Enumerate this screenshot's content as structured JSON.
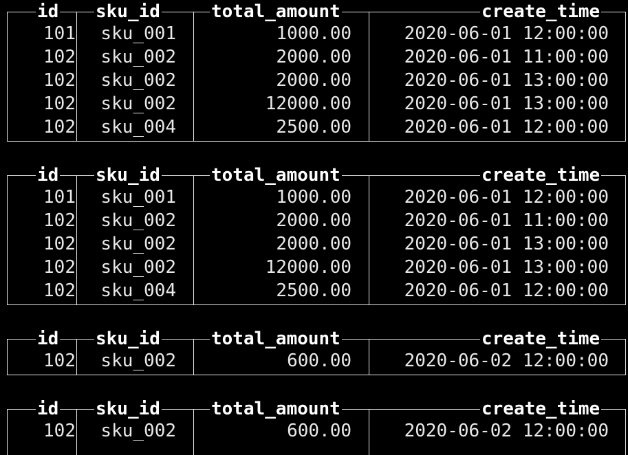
{
  "columns": [
    "id",
    "sku_id",
    "total_amount",
    "create_time"
  ],
  "tables": [
    {
      "rows": [
        [
          "101",
          "sku_001",
          "1000.00",
          "2020-06-01 12:00:00"
        ],
        [
          "102",
          "sku_002",
          "2000.00",
          "2020-06-01 11:00:00"
        ],
        [
          "102",
          "sku_002",
          "2000.00",
          "2020-06-01 13:00:00"
        ],
        [
          "102",
          "sku_002",
          "12000.00",
          "2020-06-01 13:00:00"
        ],
        [
          "102",
          "sku_004",
          "2500.00",
          "2020-06-01 12:00:00"
        ]
      ]
    },
    {
      "rows": [
        [
          "101",
          "sku_001",
          "1000.00",
          "2020-06-01 12:00:00"
        ],
        [
          "102",
          "sku_002",
          "2000.00",
          "2020-06-01 11:00:00"
        ],
        [
          "102",
          "sku_002",
          "2000.00",
          "2020-06-01 13:00:00"
        ],
        [
          "102",
          "sku_002",
          "12000.00",
          "2020-06-01 13:00:00"
        ],
        [
          "102",
          "sku_004",
          "2500.00",
          "2020-06-01 12:00:00"
        ]
      ]
    },
    {
      "rows": [
        [
          "102",
          "sku_002",
          "600.00",
          "2020-06-02 12:00:00"
        ]
      ]
    },
    {
      "rows": [
        [
          "102",
          "sku_002",
          "600.00",
          "2020-06-02 12:00:00"
        ]
      ]
    }
  ],
  "colors": {
    "background": "#000000",
    "foreground": "#e8e8e8",
    "header": "#ffffff"
  }
}
